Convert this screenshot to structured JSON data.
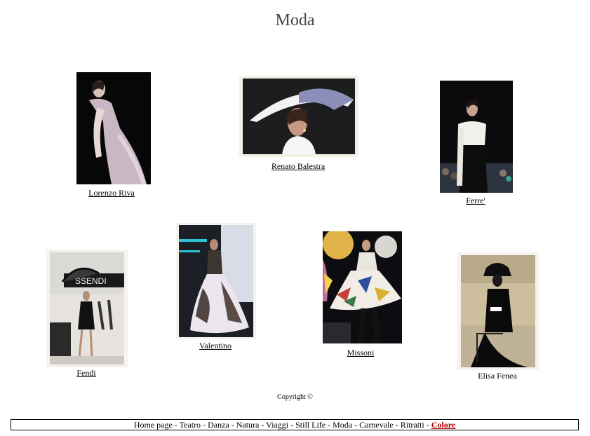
{
  "page_title": "Moda",
  "photos": [
    {
      "label": "Lorenzo Riva",
      "linked": true
    },
    {
      "label": "Renato Balestra",
      "linked": true
    },
    {
      "label": "Ferre'",
      "linked": true
    },
    {
      "label": "Fendi",
      "linked": true
    },
    {
      "label": "Valentino",
      "linked": true
    },
    {
      "label": "Missoni",
      "linked": true
    },
    {
      "label": "Elisa Fenea",
      "linked": false
    }
  ],
  "copyright": "Copyright ©",
  "nav": {
    "items": [
      {
        "label": "Home page"
      },
      {
        "label": "Teatro"
      },
      {
        "label": "Danza"
      },
      {
        "label": "Natura"
      },
      {
        "label": "Viaggi"
      },
      {
        "label": "Still Life"
      },
      {
        "label": "Moda"
      },
      {
        "label": "Carnevale"
      },
      {
        "label": "Ritratti"
      },
      {
        "label": "Colore",
        "active": true
      }
    ],
    "separator": " - "
  },
  "colors": {
    "active_link": "#b00000",
    "title": "#444444"
  }
}
